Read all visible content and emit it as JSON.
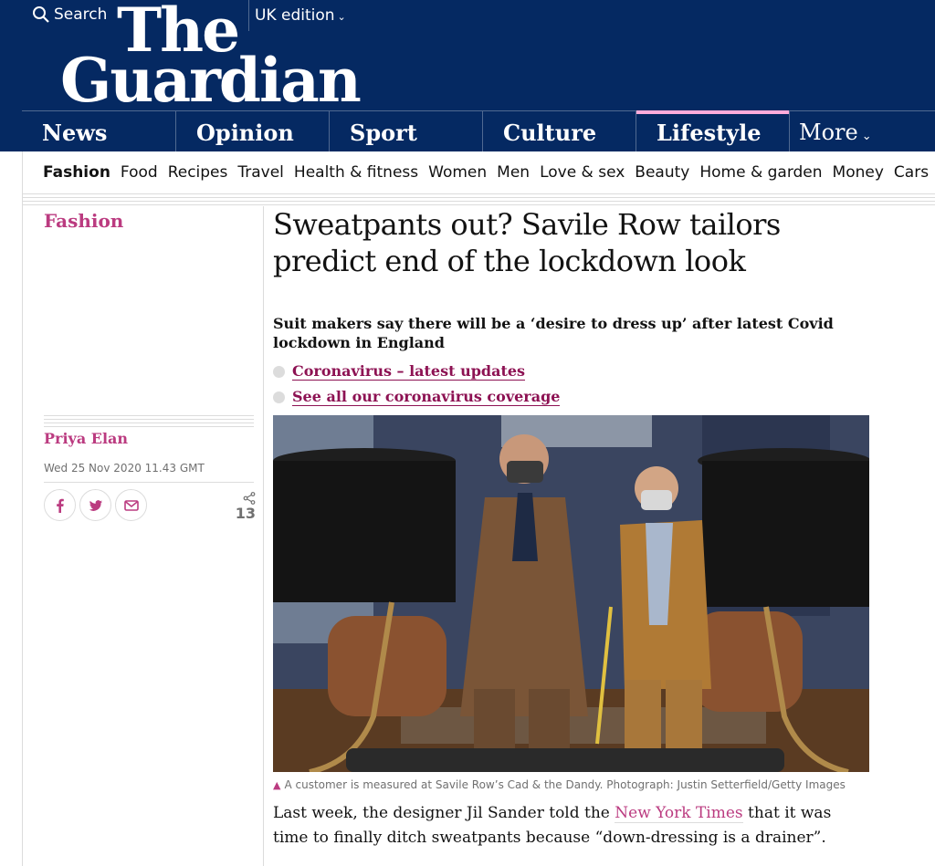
{
  "header": {
    "search_label": "Search",
    "edition_label": "UK edition",
    "logo_line1": "The",
    "logo_line2": "Guardian",
    "brand_color": "#052962"
  },
  "pillars": [
    {
      "label": "News"
    },
    {
      "label": "Opinion"
    },
    {
      "label": "Sport"
    },
    {
      "label": "Culture"
    },
    {
      "label": "Lifestyle",
      "active": true
    },
    {
      "label": "More"
    }
  ],
  "subnav": [
    "Fashion",
    "Food",
    "Recipes",
    "Travel",
    "Health & fitness",
    "Women",
    "Men",
    "Love & sex",
    "Beauty",
    "Home & garden",
    "Money",
    "Cars"
  ],
  "article": {
    "section": "Fashion",
    "headline": "Sweatpants out? Savile Row tailors predict end of the lockdown look",
    "standfirst": "Suit makers say there will be a ‘desire to dress up’ after latest Covid lockdown in England",
    "related_links": [
      "Coronavirus – latest updates",
      "See all our coronavirus coverage"
    ],
    "author": "Priya Elan",
    "date": "Wed 25 Nov 2020 11.43 GMT",
    "share_count": "13",
    "caption": "A customer is measured at Savile Row’s Cad & the Dandy. Photograph: Justin Setterfield/Getty Images",
    "body_start": "Last week, the designer Jil Sander told the ",
    "body_link": "New York Times",
    "body_end": " that it was time to finally ditch sweatpants because “down-dressing is a drainer”."
  },
  "accent_color": "#bb3b80",
  "link_color": "#8d1253"
}
